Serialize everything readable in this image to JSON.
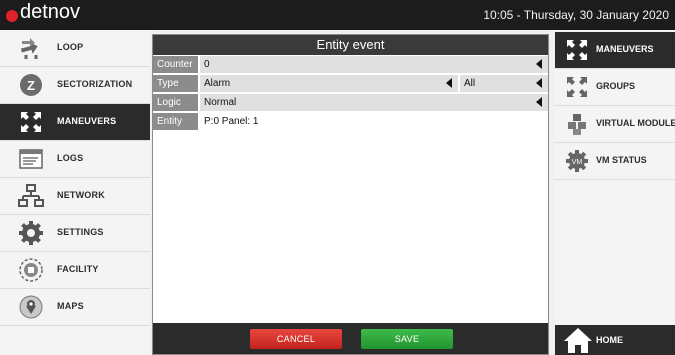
{
  "app": {
    "brand": "detnov",
    "datetime": "10:05 - Thursday, 30 January 2020"
  },
  "sidebar_left": {
    "items": [
      {
        "label": "LOOP",
        "icon": "loop-icon",
        "active": false
      },
      {
        "label": "SECTORIZATION",
        "icon": "sectorization-icon",
        "active": false
      },
      {
        "label": "MANEUVERS",
        "icon": "maneuvers-icon",
        "active": true
      },
      {
        "label": "LOGS",
        "icon": "logs-icon",
        "active": false
      },
      {
        "label": "NETWORK",
        "icon": "network-icon",
        "active": false
      },
      {
        "label": "SETTINGS",
        "icon": "gear-icon",
        "active": false
      },
      {
        "label": "FACILITY",
        "icon": "facility-icon",
        "active": false
      },
      {
        "label": "MAPS",
        "icon": "maps-icon",
        "active": false
      }
    ]
  },
  "dialog": {
    "title": "Entity event",
    "rows": {
      "counter": {
        "label": "Counter",
        "value": "0"
      },
      "type": {
        "label": "Type",
        "value": "Alarm",
        "secondary": "All"
      },
      "logic": {
        "label": "Logic",
        "value": "Normal"
      },
      "entity": {
        "label": "Entity",
        "value": "P:0 Panel: 1"
      }
    },
    "cancel_label": "CANCEL",
    "save_label": "SAVE"
  },
  "sidebar_right": {
    "items": [
      {
        "label": "MANEUVERS",
        "icon": "maneuvers-icon",
        "active": true
      },
      {
        "label": "GROUPS",
        "icon": "groups-icon",
        "active": false
      },
      {
        "label": "VIRTUAL MODULES",
        "icon": "virtual-modules-icon",
        "active": false
      },
      {
        "label": "VM STATUS",
        "icon": "vm-status-icon",
        "active": false
      }
    ],
    "home_label": "HOME"
  },
  "colors": {
    "accent_red": "#e0212b",
    "cancel": "#d1322b",
    "save": "#2fa83c",
    "dark": "#2b2b2b"
  }
}
